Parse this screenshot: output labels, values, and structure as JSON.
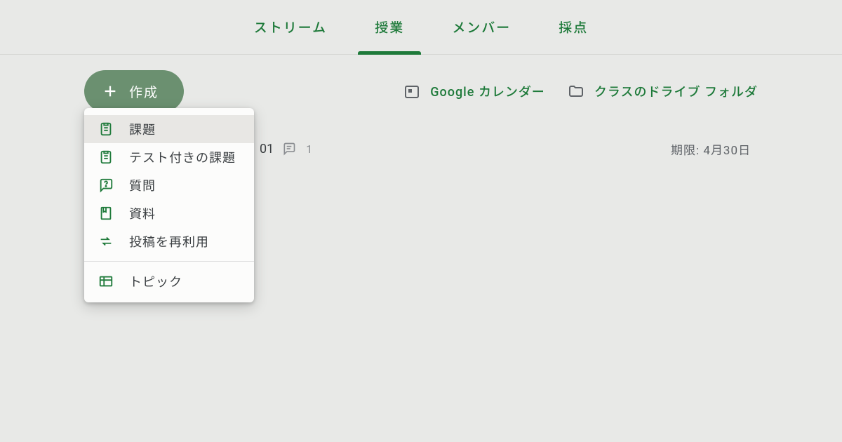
{
  "tabs": {
    "stream": "ストリーム",
    "classwork": "授業",
    "people": "メンバー",
    "grades": "採点"
  },
  "create": {
    "label": "作成"
  },
  "links": {
    "calendar": "Google カレンダー",
    "drive": "クラスのドライブ フォルダ"
  },
  "menu": {
    "assignment": "課題",
    "quiz_assignment": "テスト付きの課題",
    "question": "質問",
    "material": "資料",
    "reuse": "投稿を再利用",
    "topic": "トピック"
  },
  "row": {
    "title_suffix": "01",
    "comments": "1",
    "due": "期限: 4月30日"
  }
}
